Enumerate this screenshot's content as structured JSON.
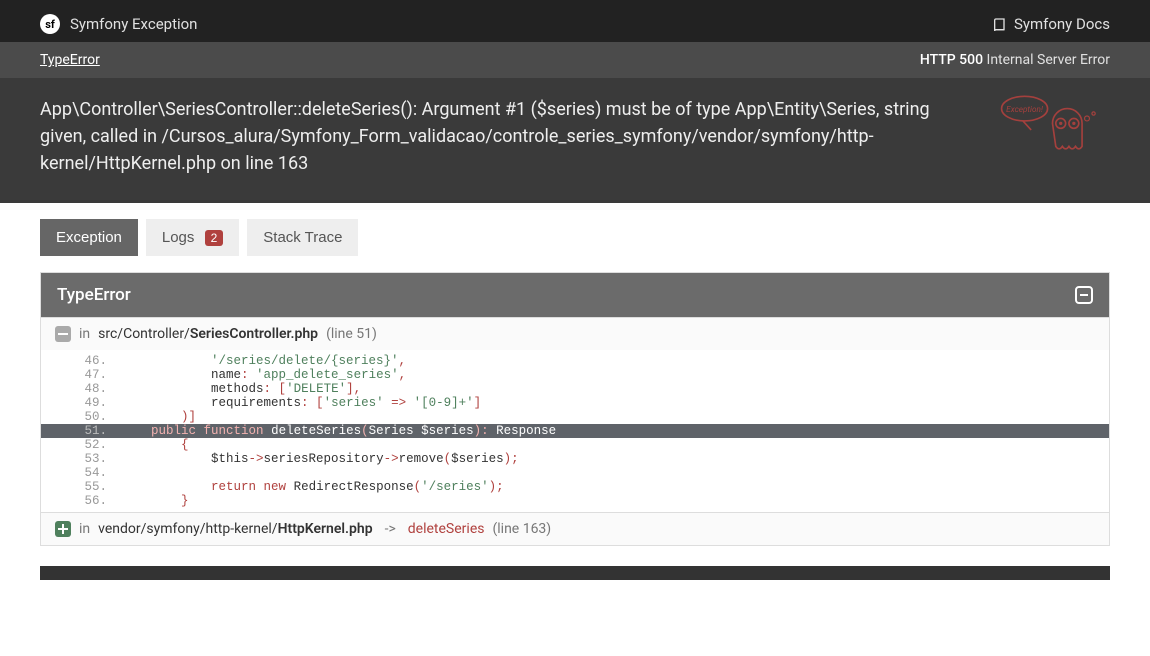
{
  "header": {
    "title": "Symfony Exception",
    "docs_label": "Symfony Docs"
  },
  "status": {
    "error_type": "TypeError",
    "http_code": "HTTP 500",
    "http_text": "Internal Server Error"
  },
  "message": "App\\Controller\\SeriesController::deleteSeries(): Argument #1 ($series) must be of type App\\Entity\\Series, string given, called in /Cursos_alura/Symfony_Form_validacao/controle_series_symfony/vendor/symfony/http-kernel/HttpKernel.php on line 163",
  "tabs": {
    "exception": "Exception",
    "logs": "Logs",
    "logs_count": "2",
    "stack": "Stack Trace"
  },
  "panel_title": "TypeError",
  "frame1": {
    "in": "in",
    "path": "src/Controller/",
    "file": "SeriesController.php",
    "line": "(line 51)"
  },
  "code": {
    "l46": {
      "no": "46.",
      "indent": "            ",
      "str": "'/series/delete/{series}'",
      "tail": ","
    },
    "l47": {
      "no": "47.",
      "indent": "            ",
      "key": "name",
      "c1": ": ",
      "str": "'app_delete_series'",
      "tail": ","
    },
    "l48": {
      "no": "48.",
      "indent": "            ",
      "key": "methods",
      "c1": ": ",
      "br": "[",
      "str": "'DELETE'",
      "brc": "],",
      "tail": ""
    },
    "l49": {
      "no": "49.",
      "indent": "            ",
      "key": "requirements",
      "c1": ": ",
      "br": "[",
      "str1": "'series'",
      "ar": " => ",
      "str2": "'[0-9]+'",
      "brc": "]"
    },
    "l50": {
      "no": "50.",
      "indent": "        ",
      "punc": ")]"
    },
    "l51": {
      "no": "51.",
      "indent": "    ",
      "kw1": "public",
      "sp1": " ",
      "kw2": "function",
      "sp2": " ",
      "fn": "deleteSeries",
      "op": "(",
      "type": "Series ",
      "var": "$series",
      "cl": "): ",
      "ret": "Response"
    },
    "l52": {
      "no": "52.",
      "indent": "        ",
      "punc": "{"
    },
    "l53": {
      "no": "53.",
      "indent": "            ",
      "var": "$this",
      "ar": "->",
      "prop": "seriesRepository",
      "ar2": "->",
      "m": "remove",
      "op": "(",
      "v2": "$series",
      "cl": ");"
    },
    "l54": {
      "no": "54.",
      "indent": ""
    },
    "l55": {
      "no": "55.",
      "indent": "            ",
      "kw": "return",
      "sp": " ",
      "kw2": "new",
      "sp2": " ",
      "cls": "RedirectResponse",
      "op": "(",
      "str": "'/series'",
      "cl": ");"
    },
    "l56": {
      "no": "56.",
      "indent": "        ",
      "punc": "}"
    }
  },
  "frame2": {
    "in": "in",
    "path": "vendor/symfony/http-kernel/",
    "file": "HttpKernel.php",
    "arrow": "->",
    "func": "deleteSeries",
    "line": "(line 163)"
  }
}
